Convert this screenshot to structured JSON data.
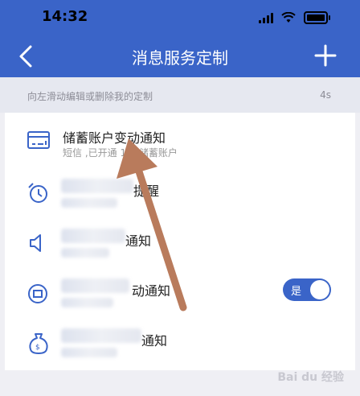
{
  "status_bar": {
    "time": "14:32"
  },
  "nav": {
    "title": "消息服务定制",
    "back_icon": "chevron-left-icon",
    "add_icon": "plus-icon"
  },
  "hint": {
    "text": "向左滑动编辑或删除我的定制",
    "time": "4s"
  },
  "items": [
    {
      "icon": "card-icon",
      "title": "储蓄账户变动通知",
      "subtitle": "短信 ,已开通 1 个储蓄账户"
    },
    {
      "icon": "alarm-clock-icon",
      "title_visible": "提醒"
    },
    {
      "icon": "speaker-icon",
      "title_visible": "通知"
    },
    {
      "icon": "badge-icon",
      "title_visible": "动通知",
      "toggle_label": "是",
      "toggle_on": true
    },
    {
      "icon": "money-bag-icon",
      "title_visible": "通知"
    }
  ],
  "watermark": "Bai du 经验",
  "colors": {
    "brand": "#3a64c8",
    "annotation_arrow": "#b97b5c"
  }
}
